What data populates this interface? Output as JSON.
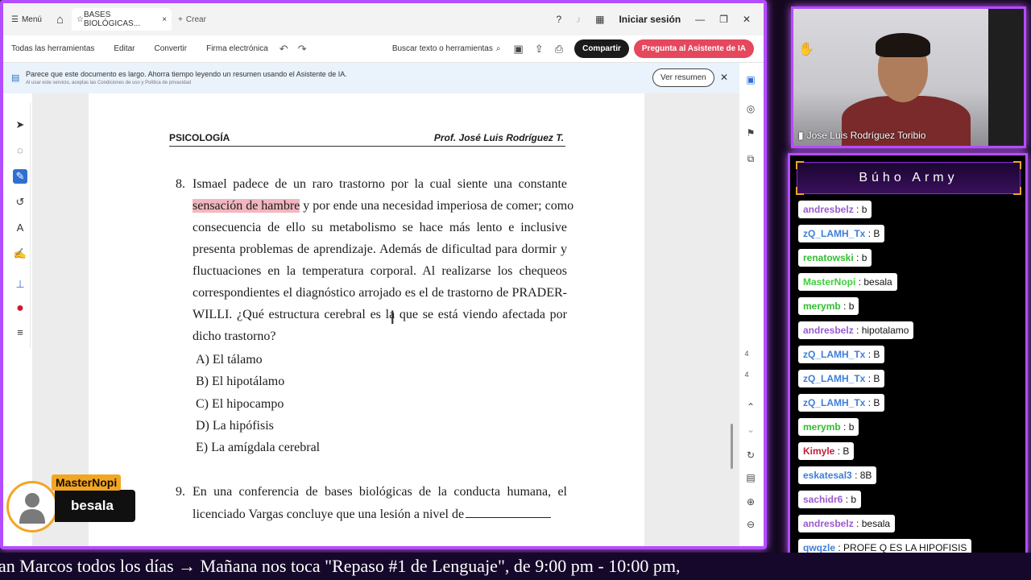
{
  "titlebar": {
    "menu_label": "Menú",
    "doc_tab_label": "BASES BIOLÓGICAS...",
    "new_tab_label": "Crear",
    "signin_label": "Iniciar sesión"
  },
  "toolbar": {
    "all_tools": "Todas las herramientas",
    "edit": "Editar",
    "convert": "Convertir",
    "esign": "Firma electrónica",
    "search_label": "Buscar texto o herramientas",
    "share_label": "Compartir",
    "ai_label": "Pregunta al Asistente de IA"
  },
  "banner": {
    "message": "Parece que este documento es largo. Ahorra tiempo leyendo un resumen usando el Asistente de IA.",
    "subtext": "Al usar este servicio, aceptas las Condiciones de uso y Política de privacidad",
    "summary_button": "Ver resumen"
  },
  "page": {
    "header_left": "PSICOLOGÍA",
    "header_right": "Prof. José Luis Rodríguez T.",
    "q8": {
      "number": "8.",
      "line1": "Ismael padece de un raro trastorno por la cual siente una constante",
      "line2_highlight": "sensación de hambre",
      "line2_rest": " y por ende una necesidad imperiosa de comer; como",
      "line3": "consecuencia de ello su metabolismo se hace más lento e inclusive",
      "line4": "presenta problemas de aprendizaje. Además de dificultad para dormir y",
      "line5": "fluctuaciones en la temperatura corporal. Al realizarse los chequeos",
      "line6": "correspondientes el diagnóstico arrojado es el de trastorno de PRADER-",
      "line7": "WILLI. ¿Qué estructura cerebral es la que se está viendo afectada por",
      "line8": "dicho trastorno?",
      "options": [
        "A) El tálamo",
        "B) El hipotálamo",
        "C) El hipocampo",
        "D) La hipófisis",
        "E) La amígdala cerebral"
      ]
    },
    "q9": {
      "number": "9.",
      "line1": "En una conferencia de bases biológicas de la conducta humana, el",
      "line2": "licenciado Vargas concluye que una lesión a nivel de"
    }
  },
  "page_indicator": {
    "current": "4",
    "total": "4"
  },
  "webcam": {
    "name": "Jose Luis Rodríguez Toribio"
  },
  "chat": {
    "title": "Búho Army",
    "messages": [
      {
        "user": "andresbelz",
        "text": ": b",
        "color": "#9b59d0"
      },
      {
        "user": "zQ_LAMH_Tx",
        "text": ": B",
        "color": "#3f7fd6"
      },
      {
        "user": "renatowski",
        "text": ": b",
        "color": "#2fbf2f"
      },
      {
        "user": "MasterNopi",
        "text": ": besala",
        "color": "#3fcf3f"
      },
      {
        "user": "merymb",
        "text": ": b",
        "color": "#2fbf2f"
      },
      {
        "user": "andresbelz",
        "text": ": hipotalamo",
        "color": "#9b59d0"
      },
      {
        "user": "zQ_LAMH_Tx",
        "text": ": B",
        "color": "#3f7fd6"
      },
      {
        "user": "zQ_LAMH_Tx",
        "text": ": B",
        "color": "#3f7fd6"
      },
      {
        "user": "zQ_LAMH_Tx",
        "text": ": B",
        "color": "#3f7fd6"
      },
      {
        "user": "merymb",
        "text": ": b",
        "color": "#2fbf2f"
      },
      {
        "user": "Kimyle",
        "text": ": B",
        "color": "#c0203a"
      },
      {
        "user": "eskatesal3",
        "text": ": 8B",
        "color": "#3f7fd6"
      },
      {
        "user": "sachidr6",
        "text": ": b",
        "color": "#9b59d0"
      },
      {
        "user": "andresbelz",
        "text": ": besala",
        "color": "#9b59d0"
      },
      {
        "user": "qwqzle",
        "text": ": PROFE Q ES LA HIPOFISIS",
        "color": "#3f7fd6"
      }
    ]
  },
  "alert": {
    "user": "MasterNopi",
    "message": "besala"
  },
  "ticker": {
    "text": "an Marcos todos los días → Mañana nos toca \"Repaso #1 de Lenguaje\", de 9:00 pm - 10:00 pm,"
  },
  "colors": {
    "accent": "#b44cff",
    "ai_button": "#e5475c",
    "alert": "#f2a623"
  }
}
